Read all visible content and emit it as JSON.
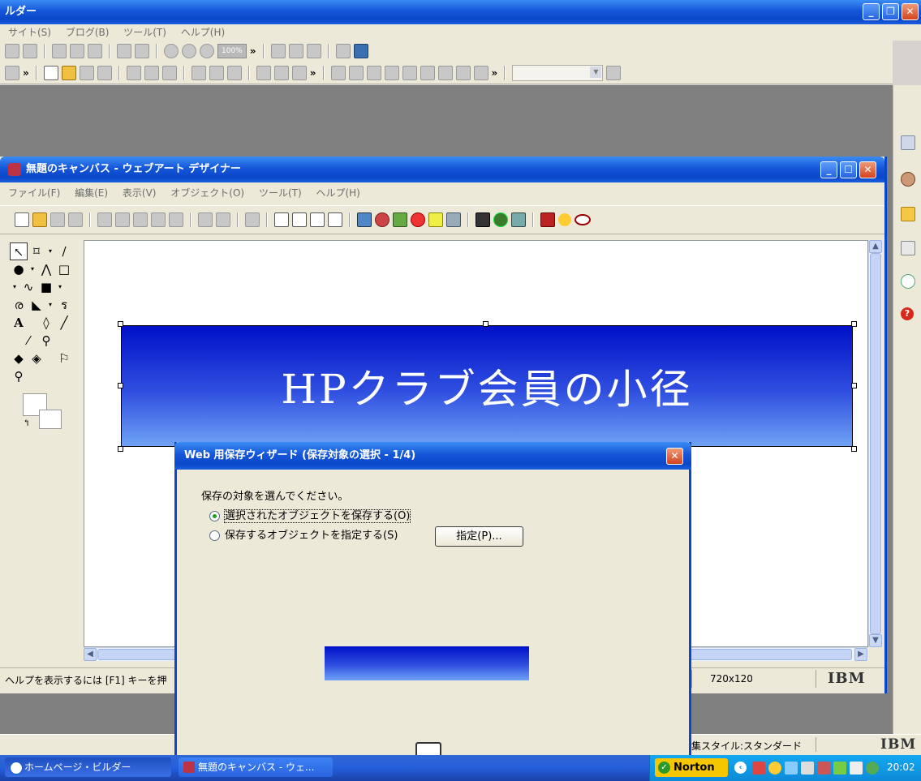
{
  "outer": {
    "title": "ルダー",
    "menu": [
      "サイト(S)",
      "ブログ(B)",
      "ツール(T)",
      "ヘルプ(H)"
    ],
    "zoom": "100%"
  },
  "canvas_window": {
    "title": "無題のキャンバス - ウェブアート デザイナー",
    "menu": [
      "ファイル(F)",
      "編集(E)",
      "表示(V)",
      "オブジェクト(O)",
      "ツール(T)",
      "ヘルプ(H)"
    ],
    "banner_text": "HPクラブ会員の小径",
    "status_help": "ヘルプを表示するには [F1] キーを押",
    "status_size": "720x120",
    "status_logo": "IBM"
  },
  "dialog": {
    "title": "Web 用保存ウィザード (保存対象の選択 - 1/4)",
    "prompt": "保存の対象を選んでください。",
    "options": [
      "選択されたオブジェクトを保存する(O)",
      "保存するオブジェクトを指定する(S)"
    ],
    "specify_button": "指定(P)..."
  },
  "outer_status": {
    "style_label": "集スタイル:スタンダード",
    "logo": "IBM"
  },
  "taskbar": {
    "buttons": [
      "ホームページ・ビルダー",
      "無題のキャンバス - ウェ..."
    ],
    "norton": "Norton",
    "clock": "20:02"
  },
  "colors": {
    "title_blue": "#0a47c9",
    "banner_top": "#0010c8",
    "banner_bottom": "#6fa2f5",
    "close_red": "#d3441e"
  }
}
